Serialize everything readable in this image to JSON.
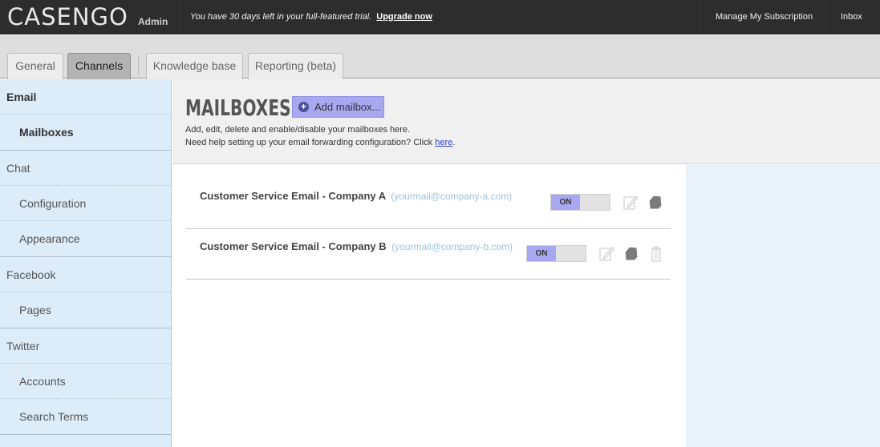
{
  "topbar": {
    "logo": "CASENGO",
    "logo_suffix": "Admin",
    "trial_text": "You have 30 days left in your full-featured trial.",
    "upgrade_link": "Upgrade now",
    "manage_link": "Manage My Subscription",
    "inbox_link": "Inbox"
  },
  "tabs": [
    {
      "label": "General",
      "active": false
    },
    {
      "label": "Channels",
      "active": true
    },
    {
      "label": "Knowledge base",
      "active": false
    },
    {
      "label": "Reporting (beta)",
      "active": false
    }
  ],
  "sidebar": {
    "groups": [
      {
        "label": "Email",
        "items": [
          "Mailboxes"
        ]
      },
      {
        "label": "Chat",
        "items": [
          "Configuration",
          "Appearance"
        ]
      },
      {
        "label": "Facebook",
        "items": [
          "Pages"
        ]
      },
      {
        "label": "Twitter",
        "items": [
          "Accounts",
          "Search Terms"
        ]
      }
    ],
    "selected": "Mailboxes"
  },
  "main": {
    "title": "MAILBOXES",
    "add_button": "Add mailbox...",
    "description_line1": "Add, edit, delete and enable/disable your mailboxes here.",
    "description_line2_prefix": "Need help setting up your email forwarding configuration? Click",
    "help_link": "here",
    "description_line2_suffix": "."
  },
  "mailboxes": [
    {
      "name": "Customer Service Email - Company A",
      "email": "(yourmail@company-a.com)",
      "toggle": "ON",
      "actions": [
        "edit-icon",
        "tag-icon"
      ]
    },
    {
      "name": "Customer Service Email - Company B",
      "email": "(yourmail@company-b.com)",
      "toggle": "ON",
      "actions": [
        "edit-icon",
        "tag-icon",
        "trash-icon"
      ]
    }
  ],
  "colors": {
    "topbar": "#2d2d2d",
    "sidebar": "#dcecf9",
    "accent": "#a7a8ef",
    "email_text": "#9cc3dd"
  }
}
